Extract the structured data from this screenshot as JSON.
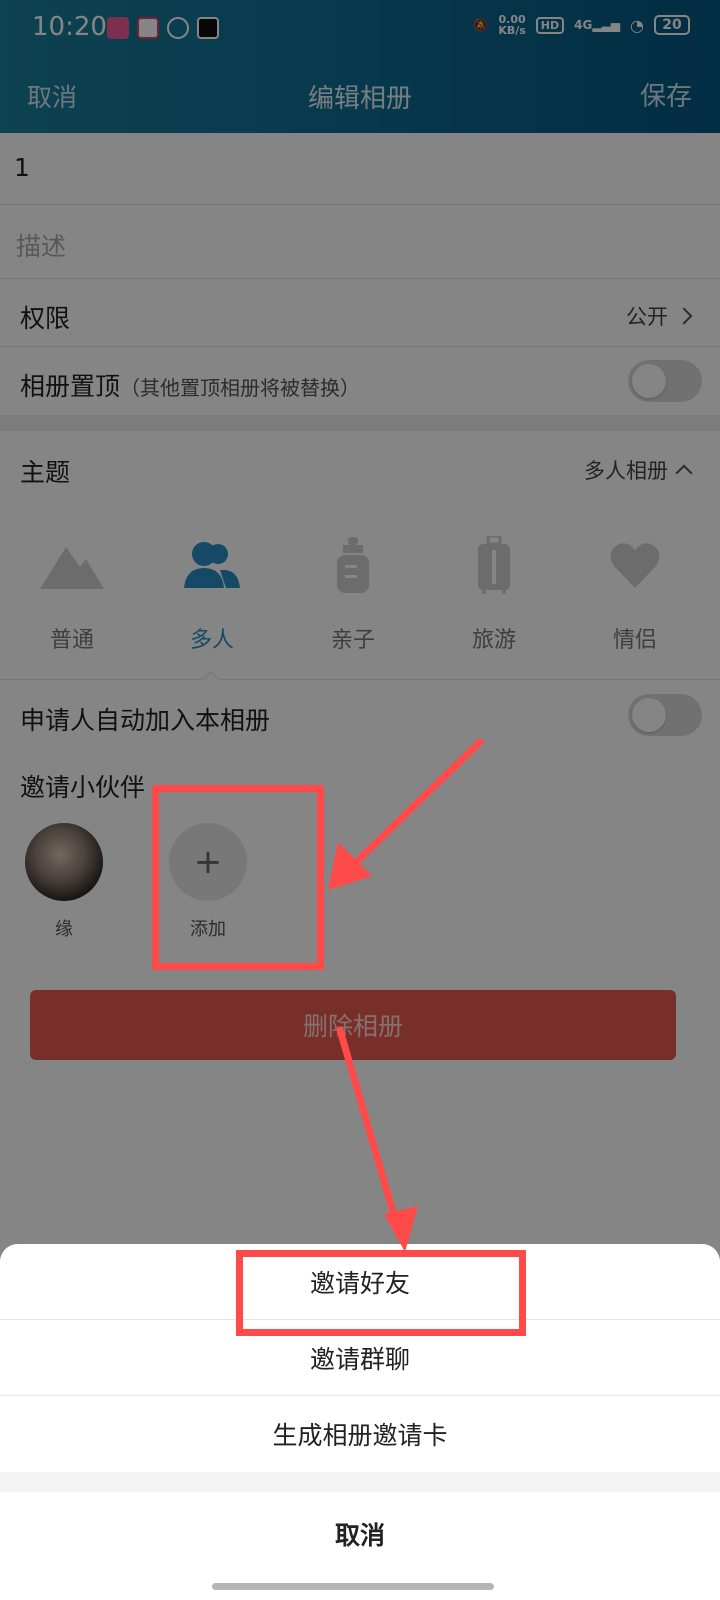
{
  "status_bar": {
    "time": "10:20",
    "net_speed_top": "0.00",
    "net_speed_unit": "KB/s",
    "hd": "HD",
    "signal": "4G",
    "battery": "20"
  },
  "navbar": {
    "cancel": "取消",
    "title": "编辑相册",
    "save": "保存"
  },
  "form": {
    "name_value": "1",
    "description_placeholder": "描述",
    "permission_label": "权限",
    "permission_value": "公开",
    "pin_label": "相册置顶",
    "pin_hint": "（其他置顶相册将被替换）",
    "theme_label": "主题",
    "theme_value": "多人相册"
  },
  "themes": [
    {
      "label": "普通",
      "icon": "mountain-icon"
    },
    {
      "label": "多人",
      "icon": "people-icon",
      "active": true
    },
    {
      "label": "亲子",
      "icon": "baby-bottle-icon"
    },
    {
      "label": "旅游",
      "icon": "luggage-icon"
    },
    {
      "label": "情侣",
      "icon": "heart-icon"
    }
  ],
  "auto_join_label": "申请人自动加入本相册",
  "invite": {
    "title": "邀请小伙伴",
    "members": [
      {
        "name": "缘"
      }
    ],
    "add_label": "添加",
    "add_symbol": "+"
  },
  "delete_button": "删除相册",
  "action_sheet": {
    "options": [
      "邀请好友",
      "邀请群聊",
      "生成相册邀请卡"
    ],
    "cancel": "取消"
  },
  "colors": {
    "header": "#0f6f95",
    "accent": "#2a8fc4",
    "delete": "#e75a4f",
    "annotation": "#ff4a4a"
  }
}
